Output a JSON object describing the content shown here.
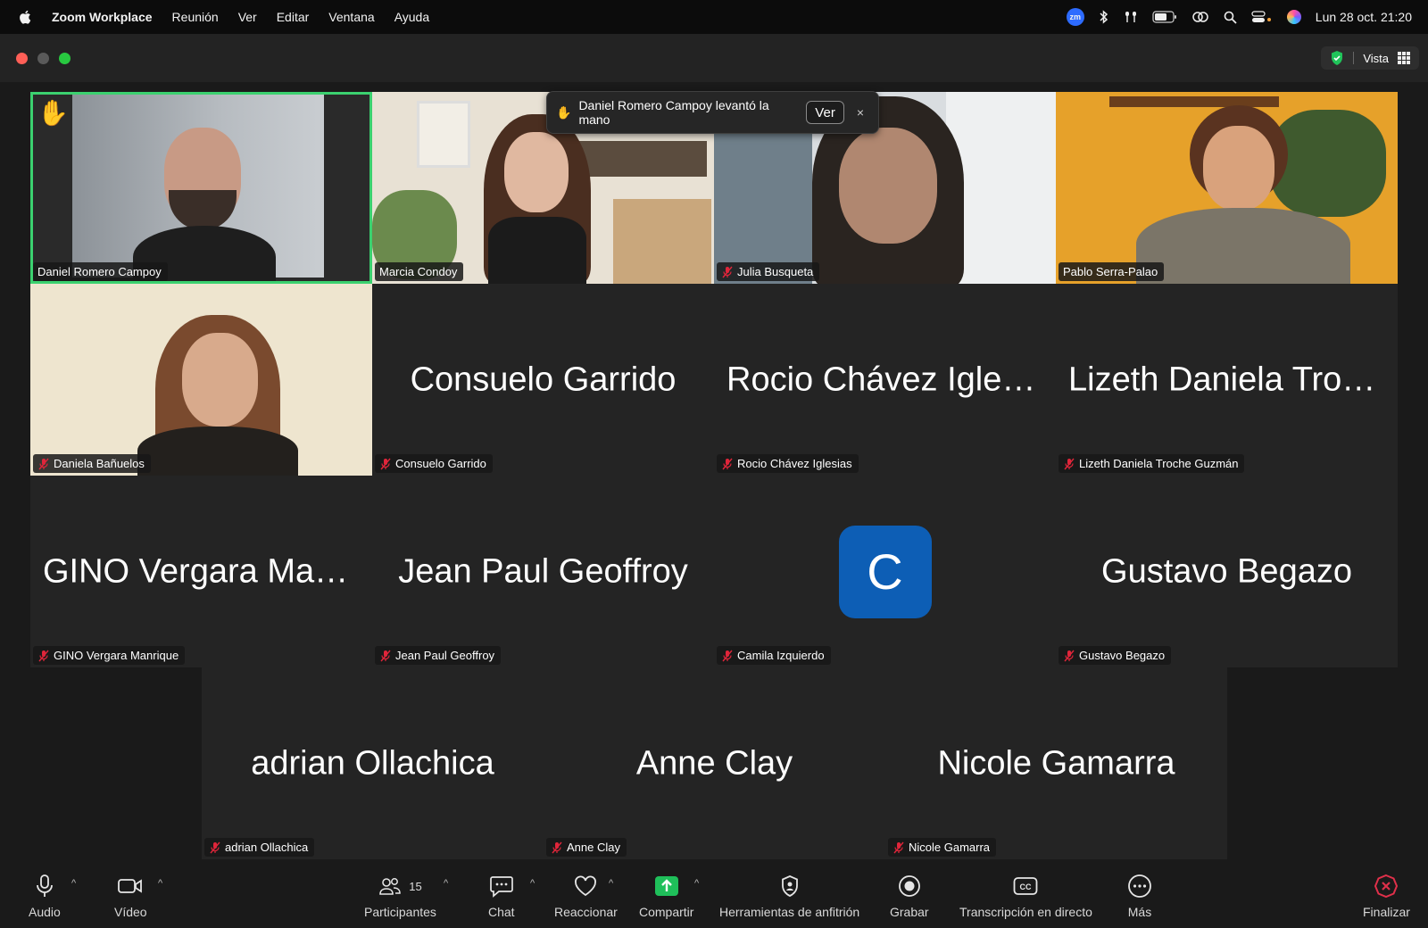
{
  "menubar": {
    "app_name": "Zoom Workplace",
    "items": [
      "Reunión",
      "Ver",
      "Editar",
      "Ventana",
      "Ayuda"
    ],
    "zoom_badge": "zm",
    "datetime": "Lun 28 oct.  21:20"
  },
  "titlebar": {
    "view_label": "Vista"
  },
  "notification": {
    "text": "Daniel Romero Campoy levantó la mano",
    "view_button": "Ver",
    "close": "×"
  },
  "tiles": [
    {
      "name": "Daniel Romero Campoy",
      "muted": false,
      "video": true,
      "active": true,
      "hand_raised": true
    },
    {
      "name": "Marcia Condoy",
      "muted": false,
      "video": true
    },
    {
      "name": "Julia Busqueta",
      "muted": true,
      "video": true
    },
    {
      "name": "Pablo Serra-Palao",
      "muted": false,
      "video": true
    },
    {
      "name": "Daniela Bañuelos",
      "muted": true,
      "video": true
    },
    {
      "name": "Consuelo Garrido",
      "display": "Consuelo Garrido",
      "muted": true
    },
    {
      "name": "Rocio Chávez Iglesias",
      "display": "Rocio Chávez Iglesias",
      "muted": true
    },
    {
      "name": "Lizeth Daniela Troche Guzmán",
      "display": "Lizeth Daniela Troch...",
      "muted": true
    },
    {
      "name": "GINO Vergara Manrique",
      "display": "GINO Vergara Manri...",
      "muted": true
    },
    {
      "name": "Jean Paul Geoffroy",
      "display": "Jean Paul Geoffroy",
      "muted": true
    },
    {
      "name": "Camila Izquierdo",
      "avatar_letter": "C",
      "muted": true
    },
    {
      "name": "Gustavo Begazo",
      "display": "Gustavo Begazo",
      "muted": true
    },
    {
      "name": "adrian Ollachica",
      "display": "adrian Ollachica",
      "muted": true
    },
    {
      "name": "Anne Clay",
      "display": "Anne Clay",
      "muted": true
    },
    {
      "name": "Nicole Gamarra",
      "display": "Nicole Gamarra",
      "muted": true
    }
  ],
  "toolbar": {
    "audio": "Audio",
    "video": "Vídeo",
    "participants": "Participantes",
    "participants_count": "15",
    "chat": "Chat",
    "react": "Reaccionar",
    "share": "Compartir",
    "host_tools": "Herramientas de anfitrión",
    "record": "Grabar",
    "captions": "Transcripción en directo",
    "more": "Más",
    "end": "Finalizar"
  },
  "colors": {
    "active_speaker": "#3bd16f",
    "share_green": "#1fbf5a",
    "avatar_blue": "#0d5eb5",
    "end_red": "#e0304a"
  }
}
